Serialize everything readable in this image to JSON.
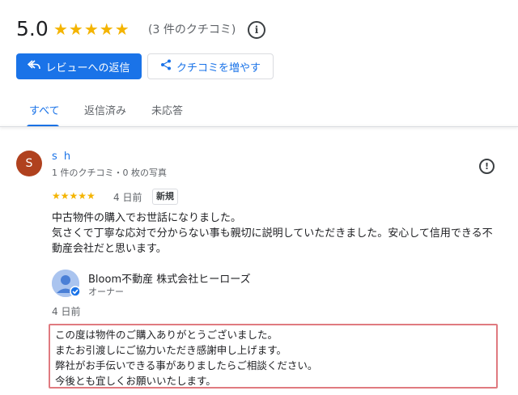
{
  "summary": {
    "rating": "5.0",
    "stars": "★★★★★",
    "count": "(3 件のクチコミ)",
    "info_icon": "i"
  },
  "buttons": {
    "reply_label": "レビューへの返信",
    "increase_label": "クチコミを増やす"
  },
  "tabs": [
    {
      "label": "すべて",
      "active": true
    },
    {
      "label": "返信済み",
      "active": false
    },
    {
      "label": "未応答",
      "active": false
    }
  ],
  "review": {
    "avatar_initial": "S",
    "avatar_color": "#b0411e",
    "reviewer_name": "s h",
    "reviewer_meta": "1 件のクチコミ・0 枚の写真",
    "stars": "★★★★★",
    "date": "4 日前",
    "badge": "新規",
    "text_lines": [
      "中古物件の購入でお世話になりました。",
      "気さくで丁寧な応対で分からない事も親切に説明していただきました。安心して信用できる不",
      "動産会社だと思います。"
    ]
  },
  "reply": {
    "owner_name": "Bloom不動産 株式会社ヒーローズ",
    "owner_role": "オーナー",
    "date": "4 日前",
    "text_lines": [
      "この度は物件のご購入ありがとうございました。",
      "またお引渡しにご協力いただき感謝申し上げます。",
      "弊社がお手伝いできる事がありましたらご相談ください。",
      "今後とも宜しくお願いいたします。"
    ]
  },
  "colors": {
    "accent": "#1a73e8",
    "star": "#f4b400",
    "highlight_border": "#e07a80"
  }
}
